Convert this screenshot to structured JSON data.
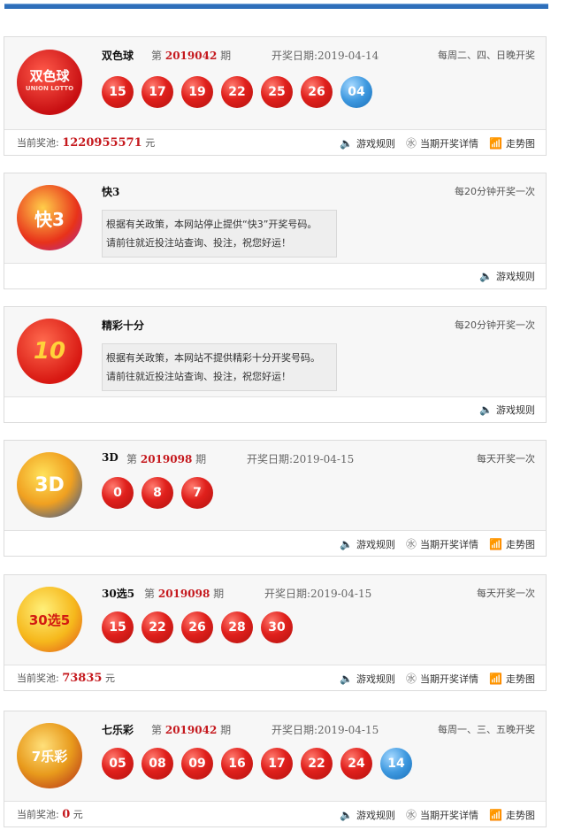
{
  "labels": {
    "issue_prefix": "第",
    "issue_suffix": "期",
    "date_prefix": "开奖日期:",
    "pool_prefix": "当前奖池:",
    "pool_unit": "元",
    "rules": "游戏规则",
    "detail": "当期开奖详情",
    "trend": "走势图"
  },
  "icons": {
    "rules": "speaker-icon",
    "detail": "lottery-detail-icon",
    "trend": "chart-icon"
  },
  "colors": {
    "accent_red": "#c5191e",
    "top_bar": "#2e6fba",
    "ball_red": "#e0201c",
    "ball_blue": "#3d98df"
  },
  "games": [
    {
      "name": "双色球",
      "issue": "2019042",
      "date": "2019-04-14",
      "schedule": "每周二、四、日晚开奖",
      "logo_text": "双色球",
      "logo_sub": "UNION LOTTO",
      "red_balls": [
        "15",
        "17",
        "19",
        "22",
        "25",
        "26"
      ],
      "blue_balls": [
        "04"
      ],
      "pool": "1220955571"
    },
    {
      "name": "快3",
      "schedule": "每20分钟开奖一次",
      "logo_text": "快3",
      "notice_line1": "根据有关政策，本网站停止提供“快3”开奖号码。",
      "notice_line2": "请前往就近投注站查询、投注，祝您好运！"
    },
    {
      "name": "精彩十分",
      "schedule": "每20分钟开奖一次",
      "logo_text": "10",
      "notice_line1": "根据有关政策，本网站不提供精彩十分开奖号码。",
      "notice_line2": "请前往就近投注站查询、投注，祝您好运！"
    },
    {
      "name": "3D",
      "issue": "2019098",
      "date": "2019-04-15",
      "schedule": "每天开奖一次",
      "logo_text": "3D",
      "red_balls": [
        "0",
        "8",
        "7"
      ]
    },
    {
      "name": "30选5",
      "issue": "2019098",
      "date": "2019-04-15",
      "schedule": "每天开奖一次",
      "logo_text": "30选5",
      "red_balls": [
        "15",
        "22",
        "26",
        "28",
        "30"
      ],
      "pool": "73835"
    },
    {
      "name": "七乐彩",
      "issue": "2019042",
      "date": "2019-04-15",
      "schedule": "每周一、三、五晚开奖",
      "logo_text": "7乐彩",
      "red_balls": [
        "05",
        "08",
        "09",
        "16",
        "17",
        "22",
        "24"
      ],
      "blue_balls": [
        "14"
      ],
      "pool": "0"
    }
  ]
}
